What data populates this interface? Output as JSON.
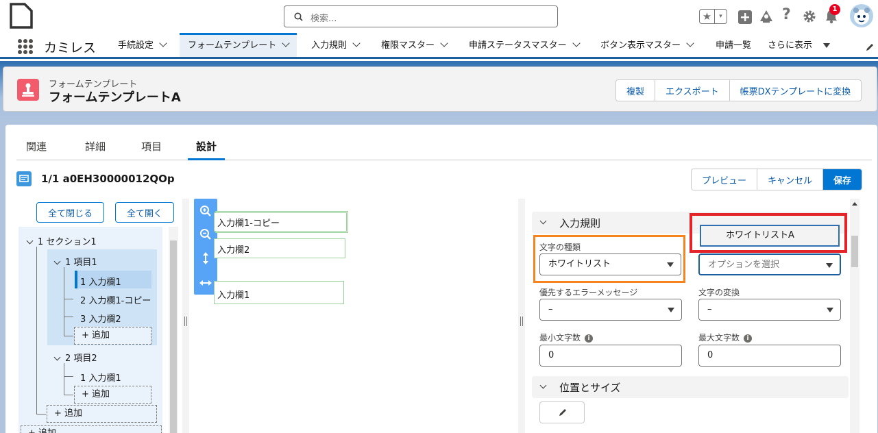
{
  "header": {
    "search_placeholder": "検索...",
    "notification_count": "1"
  },
  "nav": {
    "app_name": "カミレス",
    "items": [
      {
        "label": "手続設定"
      },
      {
        "label": "フォームテンプレート"
      },
      {
        "label": "入力規則"
      },
      {
        "label": "権限マスター"
      },
      {
        "label": "申請ステータスマスター"
      },
      {
        "label": "ボタン表示マスター"
      },
      {
        "label": "申請一覧"
      },
      {
        "label": "さらに表示"
      }
    ]
  },
  "page_header": {
    "object_label": "フォームテンプレート",
    "record_name": "フォームテンプレートA",
    "actions": [
      "複製",
      "エクスポート",
      "帳票DXテンプレートに変換"
    ]
  },
  "tabs": [
    "関連",
    "詳細",
    "項目",
    "設計"
  ],
  "designer": {
    "record_id": "1/1 a0EH30000012QOp",
    "actions": [
      "プレビュー",
      "キャンセル",
      "保存"
    ],
    "collapse_all": "全て閉じる",
    "expand_all": "全て開く"
  },
  "tree": {
    "section": "1 セクション1",
    "item1": "1 項目1",
    "item1_fields": [
      "1 入力欄1",
      "2 入力欄1-コピー",
      "3 入力欄2"
    ],
    "item2": "2 項目2",
    "item2_fields": [
      "1 入力欄1"
    ],
    "add_label": "+ 追加",
    "trailing_add": "+ 追加"
  },
  "canvas": {
    "fields": [
      "入力欄1-コピー",
      "入力欄2",
      "入力欄1"
    ]
  },
  "properties": {
    "section1_title": "入力規則",
    "char_type_label": "文字の種類",
    "char_type_value": "ホワイトリスト",
    "option_selected": "ホワイトリストA",
    "option_placeholder": "オプションを選択",
    "priority_error_label": "優先するエラーメッセージ",
    "priority_error_value": "–",
    "char_convert_label": "文字の変換",
    "char_convert_value": "–",
    "min_chars_label": "最小文字数",
    "min_chars_value": "0",
    "max_chars_label": "最大文字数",
    "max_chars_value": "0",
    "section2_title": "位置とサイズ"
  }
}
